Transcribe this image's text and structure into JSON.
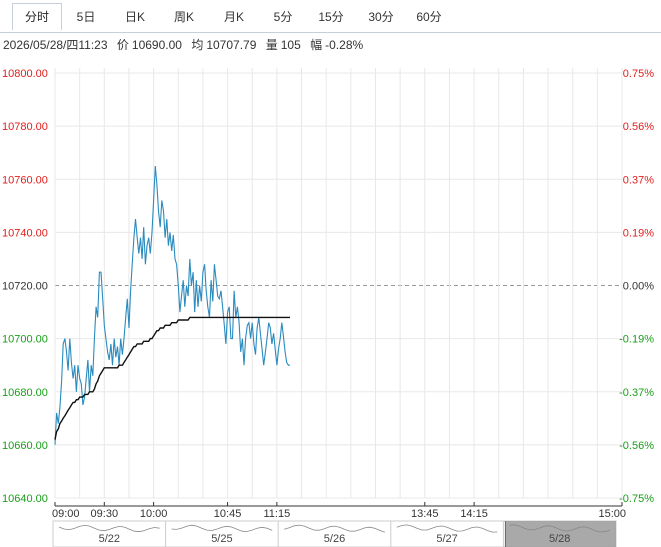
{
  "tabs": [
    {
      "label": "分时",
      "active": true
    },
    {
      "label": "5日",
      "active": false
    },
    {
      "label": "日K",
      "active": false
    },
    {
      "label": "周K",
      "active": false
    },
    {
      "label": "月K",
      "active": false
    },
    {
      "label": "5分",
      "active": false
    },
    {
      "label": "15分",
      "active": false
    },
    {
      "label": "30分",
      "active": false
    },
    {
      "label": "60分",
      "active": false
    }
  ],
  "info": {
    "datetime": "2026/05/28/四11:23",
    "price_label": "价",
    "price": "10690.00",
    "avg_label": "均",
    "avg": "10707.79",
    "volume_label": "量",
    "volume": "105",
    "change_label": "幅",
    "change": "-0.28%"
  },
  "colors": {
    "up": "#e0201e",
    "down": "#1a9d1a",
    "flat": "#333333",
    "price_line": "#2a8bbf",
    "avg_line": "#111111",
    "grid": "#e8e8e8"
  },
  "chart_data": {
    "type": "line",
    "title": "",
    "xlabel": "",
    "ylabel": "",
    "prev_close": 10720.0,
    "ylim": [
      10640,
      10800
    ],
    "left_ticks": [
      "10800.00",
      "10780.00",
      "10760.00",
      "10740.00",
      "10720.00",
      "10700.00",
      "10680.00",
      "10660.00",
      "10640.00"
    ],
    "right_ticks": [
      "0.75%",
      "0.56%",
      "0.37%",
      "0.19%",
      "0.00%",
      "-0.19%",
      "-0.37%",
      "-0.56%",
      "-0.75%"
    ],
    "x_ticks": [
      "09:00",
      "09:30",
      "10:00",
      "10:45",
      "11:15",
      "13:45",
      "14:15",
      "15:00"
    ],
    "x_minutes_total": 345,
    "series": [
      {
        "key": "price",
        "x": [
          0,
          1,
          2,
          3,
          4,
          5,
          6,
          7,
          8,
          9,
          10,
          11,
          12,
          13,
          14,
          15,
          16,
          17,
          18,
          19,
          20,
          21,
          22,
          23,
          24,
          25,
          26,
          27,
          28,
          29,
          30,
          31,
          32,
          33,
          34,
          35,
          36,
          37,
          38,
          39,
          40,
          41,
          42,
          43,
          44,
          45,
          46,
          47,
          48,
          49,
          50,
          51,
          52,
          53,
          54,
          55,
          56,
          57,
          58,
          59,
          60,
          61,
          62,
          63,
          64,
          65,
          66,
          67,
          68,
          69,
          70,
          71,
          72,
          73,
          74,
          75,
          76,
          77,
          78,
          79,
          80,
          81,
          82,
          83,
          84,
          85,
          86,
          87,
          88,
          89,
          90,
          91,
          92,
          93,
          94,
          95,
          96,
          97,
          98,
          99,
          100,
          101,
          102,
          103,
          104,
          105,
          106,
          107,
          108,
          109,
          110,
          111,
          112,
          113,
          114,
          115,
          116,
          117,
          118,
          119,
          120,
          121,
          122,
          123,
          124,
          125,
          126,
          127,
          128,
          129,
          130,
          131,
          132,
          133,
          134,
          135,
          136,
          137,
          138,
          139,
          140,
          141,
          142,
          143
        ],
        "values": [
          10660,
          10672,
          10668,
          10674,
          10684,
          10698,
          10700,
          10695,
          10688,
          10700,
          10691,
          10685,
          10690,
          10680,
          10690,
          10685,
          10683,
          10675,
          10678,
          10685,
          10692,
          10680,
          10690,
          10686,
          10700,
          10712,
          10708,
          10725,
          10725,
          10715,
          10705,
          10700,
          10695,
          10692,
          10698,
          10690,
          10700,
          10693,
          10697,
          10690,
          10700,
          10694,
          10700,
          10708,
          10715,
          10704,
          10718,
          10728,
          10738,
          10745,
          10738,
          10732,
          10738,
          10730,
          10742,
          10728,
          10735,
          10738,
          10732,
          10740,
          10752,
          10765,
          10758,
          10748,
          10742,
          10752,
          10748,
          10738,
          10745,
          10735,
          10740,
          10733,
          10739,
          10730,
          10728,
          10720,
          10710,
          10716,
          10722,
          10712,
          10720,
          10716,
          10730,
          10720,
          10725,
          10710,
          10722,
          10712,
          10720,
          10714,
          10725,
          10728,
          10718,
          10712,
          10708,
          10722,
          10714,
          10728,
          10722,
          10716,
          10715,
          10718,
          10712,
          10705,
          10698,
          10710,
          10712,
          10700,
          10700,
          10718,
          10708,
          10712,
          10706,
          10695,
          10700,
          10690,
          10700,
          10705,
          10706,
          10700,
          10706,
          10698,
          10694,
          10704,
          10708,
          10702,
          10696,
          10690,
          10695,
          10700,
          10706,
          10704,
          10698,
          10702,
          10696,
          10690,
          10696,
          10700,
          10706,
          10701,
          10695,
          10691,
          10690,
          10690
        ]
      },
      {
        "key": "average",
        "x": [
          0,
          1,
          2,
          3,
          4,
          5,
          6,
          7,
          8,
          9,
          10,
          11,
          12,
          13,
          14,
          15,
          16,
          17,
          18,
          19,
          20,
          21,
          22,
          23,
          24,
          25,
          26,
          27,
          28,
          29,
          30,
          31,
          32,
          33,
          34,
          35,
          36,
          37,
          38,
          39,
          40,
          41,
          42,
          43,
          44,
          45,
          46,
          47,
          48,
          49,
          50,
          51,
          52,
          53,
          54,
          55,
          56,
          57,
          58,
          59,
          60,
          61,
          62,
          63,
          64,
          65,
          66,
          67,
          68,
          69,
          70,
          71,
          72,
          73,
          74,
          75,
          76,
          77,
          78,
          79,
          80,
          81,
          82,
          83,
          84,
          85,
          86,
          87,
          88,
          89,
          90,
          91,
          92,
          93,
          94,
          95,
          96,
          97,
          98,
          99,
          100,
          101,
          102,
          103,
          104,
          105,
          106,
          107,
          108,
          109,
          110,
          111,
          112,
          113,
          114,
          115,
          116,
          117,
          118,
          119,
          120,
          121,
          122,
          123,
          124,
          125,
          126,
          127,
          128,
          129,
          130,
          131,
          132,
          133,
          134,
          135,
          136,
          137,
          138,
          139,
          140,
          141,
          142,
          143
        ],
        "values": [
          10662,
          10665,
          10666,
          10668,
          10669,
          10670,
          10671,
          10672,
          10673,
          10674,
          10675,
          10676,
          10676,
          10677,
          10677,
          10678,
          10678,
          10678,
          10679,
          10679,
          10679,
          10680,
          10680,
          10680,
          10681,
          10683,
          10684,
          10686,
          10687,
          10688,
          10689,
          10689,
          10689,
          10689,
          10689,
          10689,
          10689,
          10689,
          10689,
          10690,
          10690,
          10690,
          10691,
          10692,
          10693,
          10694,
          10695,
          10696,
          10697,
          10697,
          10698,
          10698,
          10698,
          10698,
          10699,
          10699,
          10699,
          10699,
          10700,
          10700,
          10701,
          10702,
          10703,
          10703,
          10704,
          10704,
          10704,
          10705,
          10705,
          10705,
          10705,
          10706,
          10706,
          10706,
          10706,
          10707,
          10707,
          10707,
          10707,
          10707,
          10707,
          10707,
          10708,
          10708,
          10708,
          10708,
          10708,
          10708,
          10708,
          10708,
          10708,
          10708,
          10708,
          10708,
          10708,
          10708,
          10708,
          10708,
          10708,
          10708,
          10708,
          10708,
          10708,
          10708,
          10708,
          10708,
          10708,
          10708,
          10708,
          10708,
          10708,
          10708,
          10708,
          10708,
          10708,
          10708,
          10708,
          10708,
          10708,
          10708,
          10708,
          10708,
          10708,
          10708,
          10708,
          10708,
          10708,
          10708,
          10708,
          10708,
          10708,
          10708,
          10708,
          10708,
          10708,
          10708,
          10708,
          10708,
          10708,
          10708,
          10708,
          10708,
          10708,
          10708
        ]
      }
    ]
  },
  "navigator": {
    "dates": [
      "5/22",
      "5/25",
      "5/26",
      "5/27",
      "5/28"
    ],
    "selected": "5/28"
  }
}
